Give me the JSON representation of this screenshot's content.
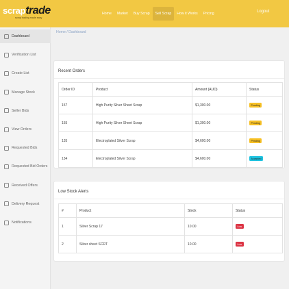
{
  "header": {
    "logo_scrap": "scrap",
    "logo_trade": "trade",
    "logo_tagline": "scrap trading made easy",
    "nav": [
      "Home",
      "Market",
      "Buy Scrap",
      "Sell Scrap",
      "How it Works",
      "Pricing"
    ],
    "active_nav": "Sell Scrap",
    "logout": "Logout"
  },
  "sidebar": {
    "items": [
      "Dashboard",
      "Verification List",
      "Create List",
      "Manage Stock",
      "Seller Bids",
      "View Orders",
      "Requested Bids",
      "Requested Bid Orders",
      "Received Offers",
      "Delivery Request",
      "Notifications"
    ],
    "active_item": "Dashboard"
  },
  "breadcrumb": "Home / Dashboard",
  "recent_orders": {
    "title": "Recent Orders",
    "columns": [
      "Order ID",
      "Product",
      "Amount (AUD)",
      "Status"
    ],
    "rows": [
      {
        "id": "157",
        "product": "High Purity Silver Sheet Scrap",
        "amount": "$1,300.00",
        "status": "Pending",
        "status_color": "#f7c024"
      },
      {
        "id": "155",
        "product": "High Purity Silver Sheet Scrap",
        "amount": "$1,300.00",
        "status": "Pending",
        "status_color": "#f7c024"
      },
      {
        "id": "135",
        "product": "Electroplated Silver Scrap",
        "amount": "$4,600.00",
        "status": "Pending",
        "status_color": "#f7c024"
      },
      {
        "id": "134",
        "product": "Electroplated Silver Scrap",
        "amount": "$4,600.00",
        "status": "Accepted",
        "status_color": "#1ec3e0"
      }
    ]
  },
  "low_stock": {
    "title": "Low Stock Alerts",
    "columns": [
      "#",
      "Product",
      "Stock",
      "Status"
    ],
    "rows": [
      {
        "num": "1",
        "product": "Silver Scrap 17",
        "stock": "10.00",
        "status": "Low",
        "status_color": "#dc3545"
      },
      {
        "num": "2",
        "product": "Silver sheet SCRT",
        "stock": "10.00",
        "status": "Low",
        "status_color": "#dc3545"
      }
    ]
  }
}
